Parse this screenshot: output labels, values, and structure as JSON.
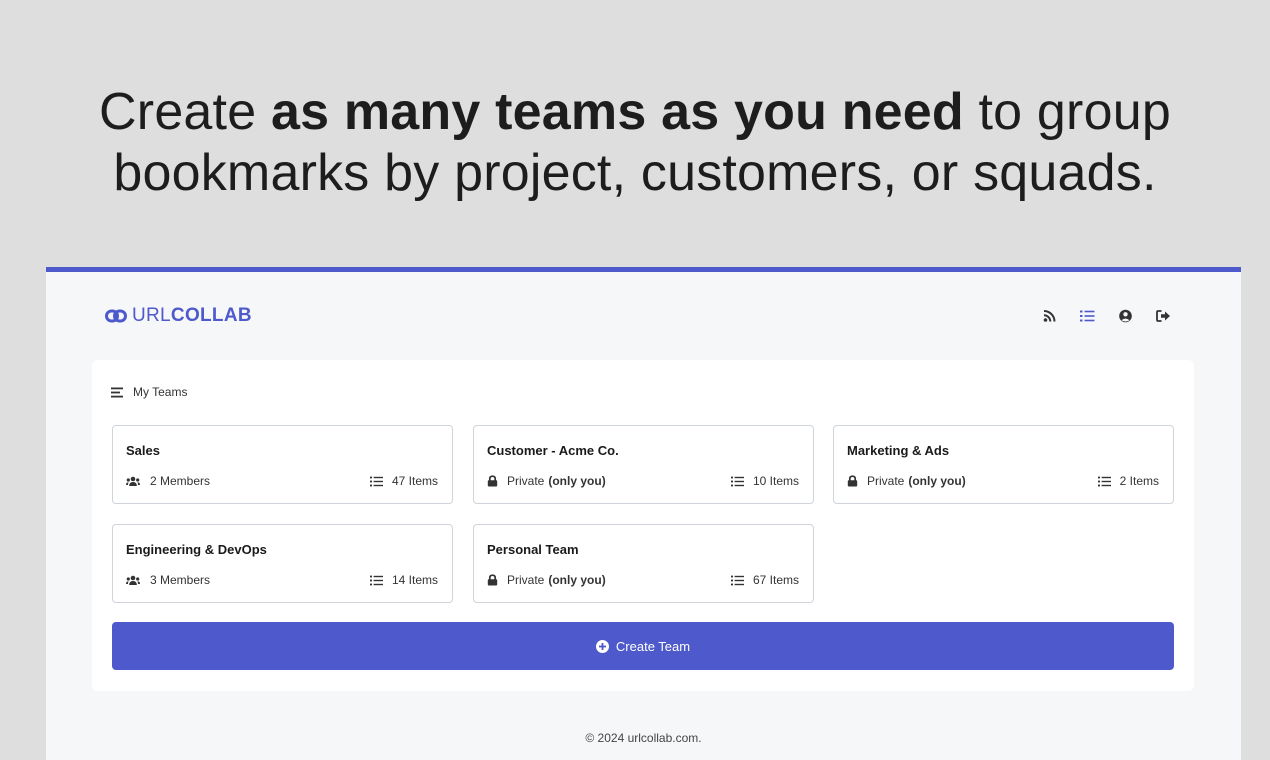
{
  "headline": {
    "part1": "Create ",
    "bold": "as many teams as you need",
    "part2": " to group",
    "line2": "bookmarks by project, customers, or squads."
  },
  "app": {
    "accent_color": "#4e59cc",
    "logo": {
      "light": "URL",
      "bold": "COLLAB",
      "icon": "link-icon"
    },
    "nav": [
      {
        "name": "rss-icon"
      },
      {
        "name": "list-icon"
      },
      {
        "name": "user-circle-icon"
      },
      {
        "name": "sign-out-icon"
      }
    ],
    "panel": {
      "title": "My Teams",
      "teams": [
        {
          "name": "Sales",
          "access": "2 Members",
          "access_bold": "",
          "items": "47 Items",
          "type": "members"
        },
        {
          "name": "Customer - Acme Co.",
          "access": "Private",
          "access_bold": "(only you)",
          "items": "10 Items",
          "type": "private"
        },
        {
          "name": "Marketing & Ads",
          "access": "Private",
          "access_bold": "(only you)",
          "items": "2 Items",
          "type": "private"
        },
        {
          "name": "Engineering & DevOps",
          "access": "3 Members",
          "access_bold": "",
          "items": "14 Items",
          "type": "members"
        },
        {
          "name": "Personal Team",
          "access": "Private",
          "access_bold": "(only you)",
          "items": "67 Items",
          "type": "private"
        }
      ],
      "create_label": "Create Team"
    },
    "footer": "© 2024 urlcollab.com."
  }
}
